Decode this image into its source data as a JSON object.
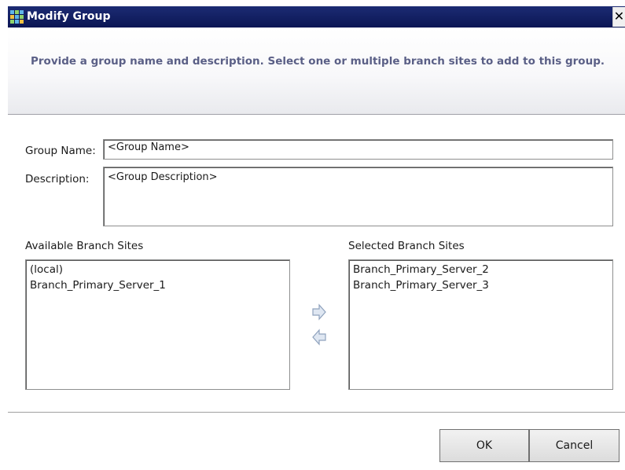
{
  "window": {
    "title": "Modify Group",
    "close_glyph": "✕"
  },
  "banner": {
    "instructions": "Provide a group name and description. Select one or multiple branch sites to add to this group."
  },
  "form": {
    "group_name_label": "Group Name:",
    "group_name_value": "<Group Name>",
    "description_label": "Description:",
    "description_value": "<Group Description>"
  },
  "available": {
    "header": "Available Branch Sites",
    "items": [
      "(local)",
      "Branch_Primary_Server_1"
    ]
  },
  "selected": {
    "header": "Selected Branch Sites",
    "items": [
      "Branch_Primary_Server_2",
      "Branch_Primary_Server_3"
    ]
  },
  "buttons": {
    "ok": "OK",
    "cancel": "Cancel"
  },
  "icons": {
    "app": "group-grid-icon",
    "add": "arrow-right-icon",
    "remove": "arrow-left-icon"
  },
  "colors": {
    "titlebar": "#0b1654",
    "banner_text": "#5a5f86"
  }
}
